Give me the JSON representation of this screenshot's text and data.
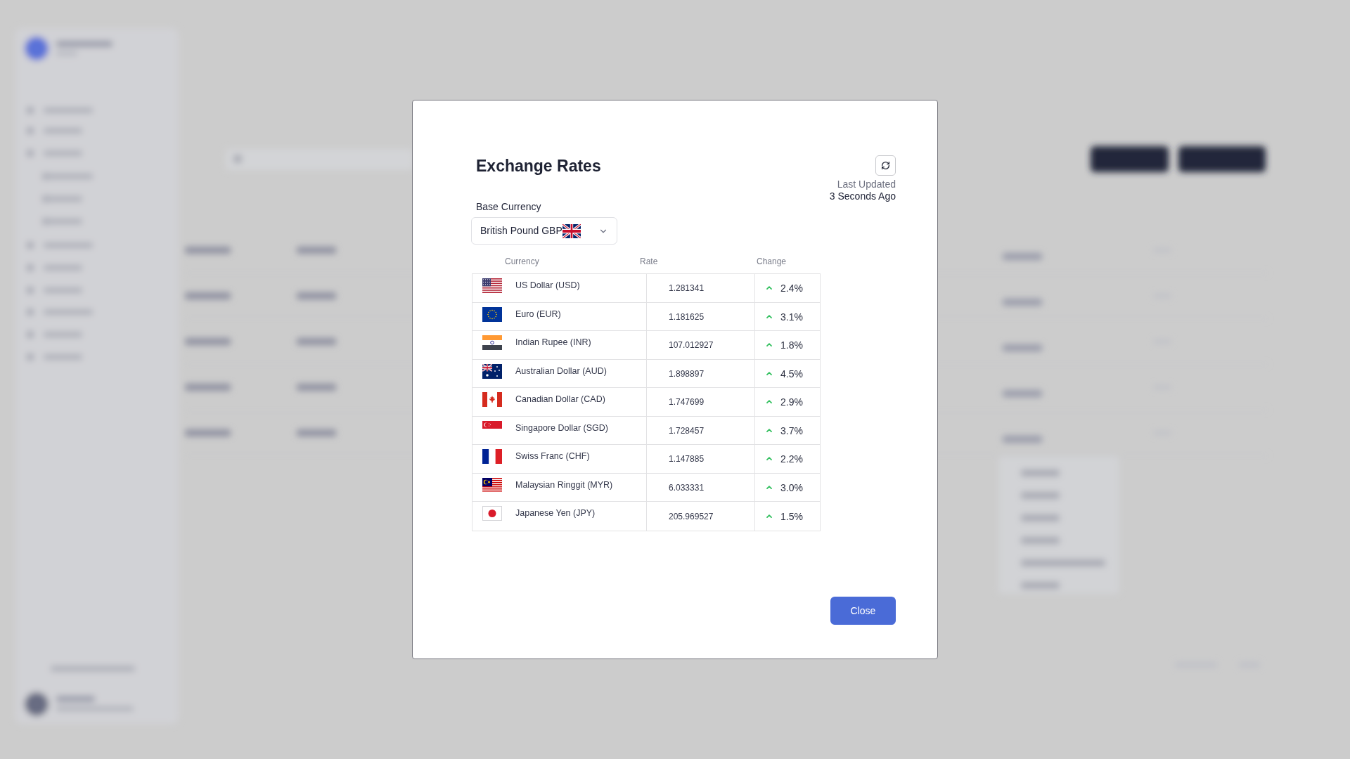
{
  "dialog": {
    "title": "Exchange Rates",
    "last_updated": {
      "label": "Last Updated",
      "value": "3 Seconds Ago"
    },
    "base_currency": {
      "label": "Base Currency",
      "value": "British Pound GBP"
    },
    "table": {
      "columns": [
        "Currency",
        "Rate",
        "Change"
      ],
      "rows": [
        {
          "currency": "US Dollar (USD)",
          "rate": "1.281341",
          "change": "2.4%"
        },
        {
          "currency": "Euro (EUR)",
          "rate": "1.181625",
          "change": "3.1%"
        },
        {
          "currency": "Indian Rupee (INR)",
          "rate": "107.012927",
          "change": "1.8%"
        },
        {
          "currency": "Australian Dollar (AUD)",
          "rate": "1.898897",
          "change": "4.5%"
        },
        {
          "currency": "Canadian Dollar (CAD)",
          "rate": "1.747699",
          "change": "2.9%"
        },
        {
          "currency": "Singapore Dollar (SGD)",
          "rate": "1.728457",
          "change": "3.7%"
        },
        {
          "currency": "Swiss Franc (CHF)",
          "rate": "1.147885",
          "change": "2.2%"
        },
        {
          "currency": "Malaysian Ringgit (MYR)",
          "rate": "6.033331",
          "change": "3.0%"
        },
        {
          "currency": "Japanese Yen (JPY)",
          "rate": "205.969527",
          "change": "1.5%"
        }
      ]
    },
    "buttons": [
      {
        "label": "Close",
        "kind": "primary"
      }
    ]
  }
}
